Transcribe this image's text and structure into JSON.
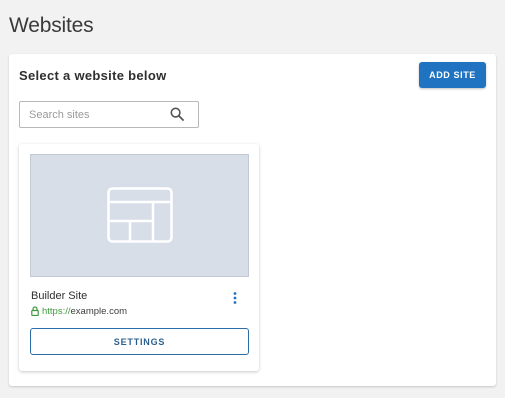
{
  "page": {
    "title": "Websites"
  },
  "panel": {
    "heading": "Select a website below",
    "add_site_label": "ADD SITE",
    "search": {
      "placeholder": "Search sites",
      "value": ""
    }
  },
  "sites": [
    {
      "name": "Builder Site",
      "url_scheme": "https://",
      "url_host": "example.com",
      "thumbnail_icon": "layout-icon",
      "menu_icon": "more-vertical-icon",
      "settings_label": "SETTINGS"
    }
  ],
  "colors": {
    "background": "#f2f2f2",
    "primary": "#1f73c1",
    "thumbnail": "#d7dee8",
    "secure_url": "#3f9a3f",
    "settings_border": "#2b6ea8"
  }
}
